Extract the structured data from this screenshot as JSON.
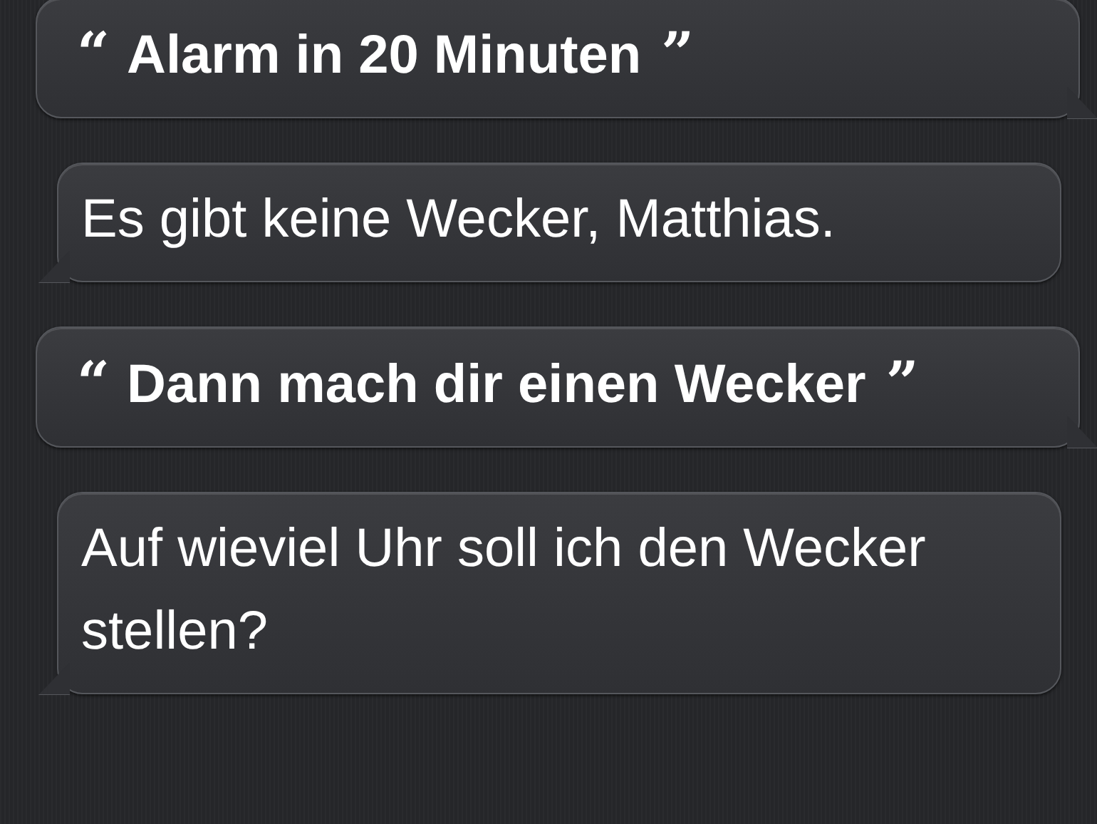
{
  "messages": [
    {
      "kind": "user",
      "open_quote": "“",
      "text": "Alarm in 20 Minuten",
      "close_quote": "”"
    },
    {
      "kind": "siri",
      "text": "Es gibt keine Wecker, Matthias."
    },
    {
      "kind": "user",
      "open_quote": "“",
      "text": "Dann mach dir einen Wecker",
      "close_quote": "”"
    },
    {
      "kind": "siri",
      "text": "Auf wieviel Uhr soll ich den Wecker stellen?"
    }
  ]
}
